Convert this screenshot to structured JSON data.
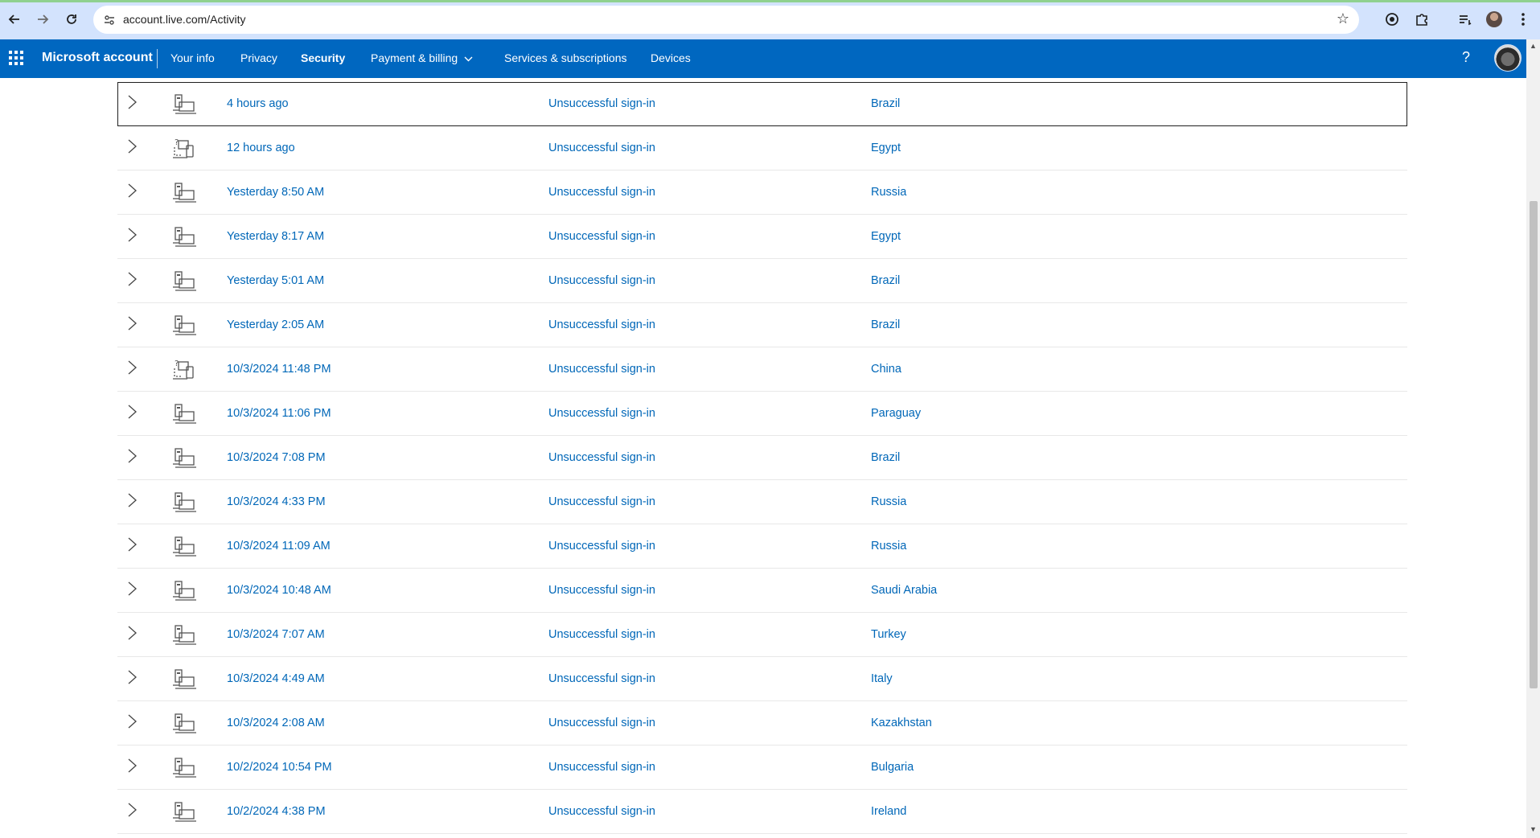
{
  "browser": {
    "url": "account.live.com/Activity",
    "icons": [
      "back-arrow-icon",
      "forward-arrow-icon",
      "reload-icon",
      "site-info-icon",
      "bookmark-star-icon",
      "extension-circle-icon",
      "extensions-puzzle-icon",
      "reading-list-icon",
      "profile-icon",
      "menu-dots-icon"
    ]
  },
  "header": {
    "brand": "Microsoft account",
    "nav": {
      "your_info": "Your info",
      "privacy": "Privacy",
      "security": "Security",
      "payment": "Payment & billing",
      "services": "Services & subscriptions",
      "devices": "Devices"
    },
    "help": "?",
    "accent": "#0067c0"
  },
  "activity": {
    "link_color": "#0067b8",
    "rows": [
      {
        "time": "4 hours ago",
        "status": "Unsuccessful sign-in",
        "location": "Brazil",
        "device": "computer-icon"
      },
      {
        "time": "12 hours ago",
        "status": "Unsuccessful sign-in",
        "location": "Egypt",
        "device": "unknown-device-icon"
      },
      {
        "time": "Yesterday 8:50 AM",
        "status": "Unsuccessful sign-in",
        "location": "Russia",
        "device": "computer-icon"
      },
      {
        "time": "Yesterday 8:17 AM",
        "status": "Unsuccessful sign-in",
        "location": "Egypt",
        "device": "computer-icon"
      },
      {
        "time": "Yesterday 5:01 AM",
        "status": "Unsuccessful sign-in",
        "location": "Brazil",
        "device": "computer-icon"
      },
      {
        "time": "Yesterday 2:05 AM",
        "status": "Unsuccessful sign-in",
        "location": "Brazil",
        "device": "computer-icon"
      },
      {
        "time": "10/3/2024 11:48 PM",
        "status": "Unsuccessful sign-in",
        "location": "China",
        "device": "unknown-device-icon"
      },
      {
        "time": "10/3/2024 11:06 PM",
        "status": "Unsuccessful sign-in",
        "location": "Paraguay",
        "device": "computer-icon"
      },
      {
        "time": "10/3/2024 7:08 PM",
        "status": "Unsuccessful sign-in",
        "location": "Brazil",
        "device": "computer-icon"
      },
      {
        "time": "10/3/2024 4:33 PM",
        "status": "Unsuccessful sign-in",
        "location": "Russia",
        "device": "computer-icon"
      },
      {
        "time": "10/3/2024 11:09 AM",
        "status": "Unsuccessful sign-in",
        "location": "Russia",
        "device": "computer-icon"
      },
      {
        "time": "10/3/2024 10:48 AM",
        "status": "Unsuccessful sign-in",
        "location": "Saudi Arabia",
        "device": "computer-icon"
      },
      {
        "time": "10/3/2024 7:07 AM",
        "status": "Unsuccessful sign-in",
        "location": "Turkey",
        "device": "computer-icon"
      },
      {
        "time": "10/3/2024 4:49 AM",
        "status": "Unsuccessful sign-in",
        "location": "Italy",
        "device": "computer-icon"
      },
      {
        "time": "10/3/2024 2:08 AM",
        "status": "Unsuccessful sign-in",
        "location": "Kazakhstan",
        "device": "computer-icon"
      },
      {
        "time": "10/2/2024 10:54 PM",
        "status": "Unsuccessful sign-in",
        "location": "Bulgaria",
        "device": "computer-icon"
      },
      {
        "time": "10/2/2024 4:38 PM",
        "status": "Unsuccessful sign-in",
        "location": "Ireland",
        "device": "computer-icon"
      }
    ]
  }
}
